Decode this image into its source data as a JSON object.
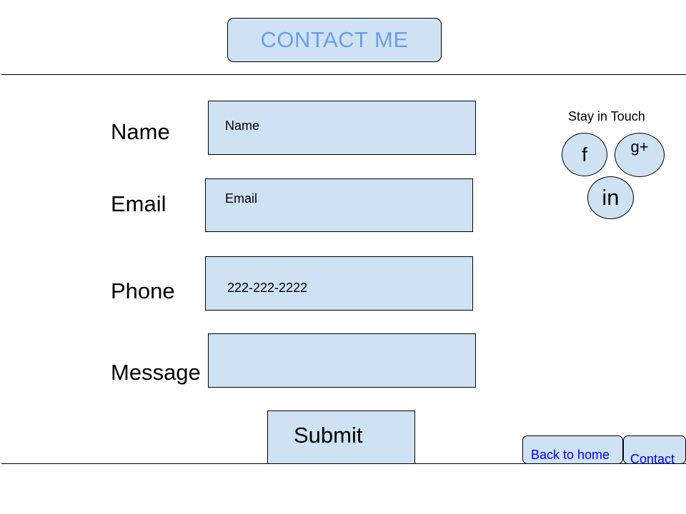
{
  "header": {
    "title": "CONTACT ME"
  },
  "form": {
    "name_label": "Name",
    "name_placeholder": "Name",
    "email_label": "Email",
    "email_placeholder": "Email",
    "phone_label": "Phone",
    "phone_value": "222-222-2222",
    "message_label": "Message",
    "message_value": "",
    "submit_label": "Submit"
  },
  "social": {
    "heading": "Stay in Touch",
    "facebook_glyph": "f",
    "googleplus_glyph": "g+",
    "linkedin_glyph": "in"
  },
  "footer": {
    "back_home_label": "Back to home",
    "contact_label": "Contact"
  },
  "colors": {
    "box_fill": "#cfe2f3",
    "title_text": "#6d9eeb",
    "link_text": "#0000ff"
  }
}
